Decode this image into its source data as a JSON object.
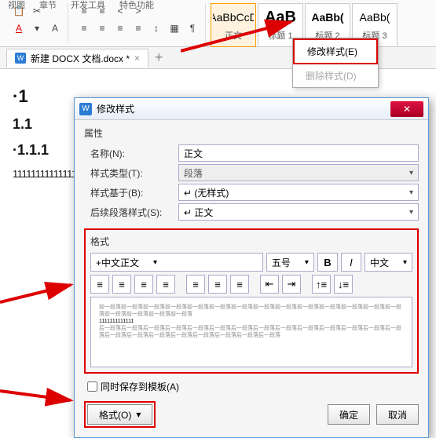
{
  "ribbon_tabs": [
    "视图",
    "章节",
    "开发工具",
    "特色功能"
  ],
  "style_items": [
    {
      "preview": "AaBbCcD",
      "name": "正文"
    },
    {
      "preview": "AaB",
      "name": "标题 1",
      "big": true
    },
    {
      "preview": "AaBb(",
      "name": "标题 2"
    },
    {
      "preview": "AaBb(",
      "name": "标题 3"
    }
  ],
  "context_menu": {
    "modify": "修改样式(E)",
    "delete": "删除样式(D)"
  },
  "doc_tab": {
    "name": "新建 DOCX 文档.docx *"
  },
  "doc_lines": {
    "l1": "·1",
    "l2": "1.1",
    "l3": "·1.1.1",
    "nums": "11111111111111"
  },
  "dialog": {
    "title": "修改样式",
    "props_label": "属性",
    "name_label": "名称(N):",
    "name_value": "正文",
    "type_label": "样式类型(T):",
    "type_value": "段落",
    "based_label": "样式基于(B):",
    "based_value": "↵ (无样式)",
    "follow_label": "后续段落样式(S):",
    "follow_value": "↵ 正文",
    "format_label": "格式",
    "font_family": "+中文正文",
    "font_size": "五号",
    "lang": "中文",
    "bold": "B",
    "italic": "I",
    "preview_gray": "前一段落前一段落前一段落前一段落前一段落前一段落前一段落前一段落前一段落前一段落前一段落前一段落前一段落前一段落前一段落前一段落前一段落前一段落",
    "preview_black": "1111111111111",
    "preview_gray2": "后一段落后一段落后一段落后一段落后一段落后一段落后一段落后一段落后一段落后一段落后一段落后一段落后一段落后一段落后一段落后一段落后一段落后一段落后一段落后一段落后一段落后一段落",
    "save_template": "同时保存到模板(A)",
    "format_btn": "格式(O)",
    "ok": "确定",
    "cancel": "取消"
  }
}
